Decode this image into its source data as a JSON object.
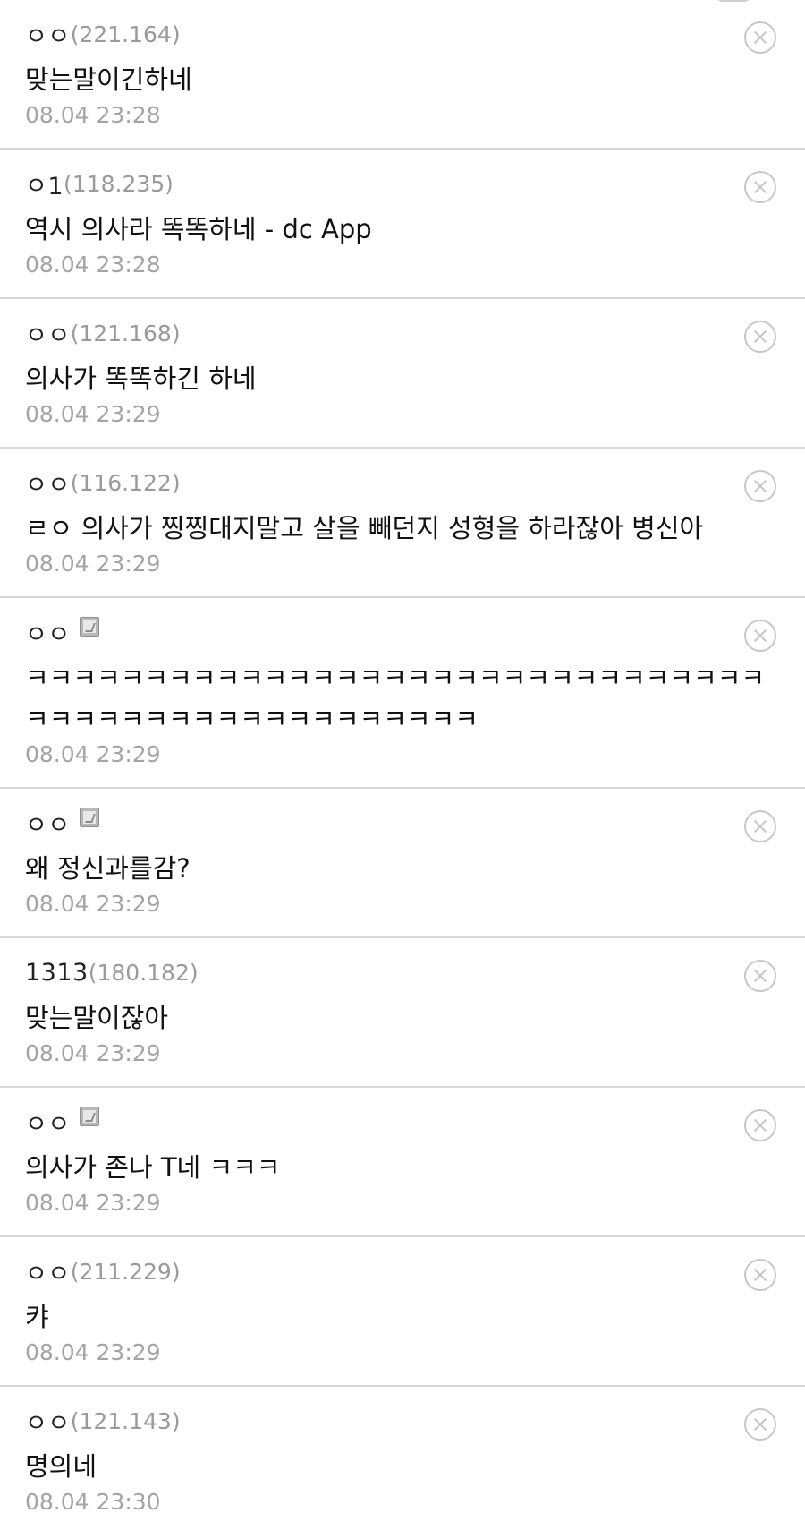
{
  "comments": [
    {
      "nick": "ㅇㅇ",
      "ip": "(221.164)",
      "fixed": false,
      "text": "맞는말이긴하네",
      "time": "08.04 23:28"
    },
    {
      "nick": "ㅇ1",
      "ip": "(118.235)",
      "fixed": false,
      "text": "역시 의사라 똑똑하네 - dc App",
      "time": "08.04 23:28"
    },
    {
      "nick": "ㅇㅇ",
      "ip": "(121.168)",
      "fixed": false,
      "text": "의사가 똑똑하긴 하네",
      "time": "08.04 23:29"
    },
    {
      "nick": "ㅇㅇ",
      "ip": "(116.122)",
      "fixed": false,
      "text": "ㄹㅇ 의사가 찡찡대지말고 살을 빼던지 성형을 하라잖아 병신아",
      "time": "08.04 23:29"
    },
    {
      "nick": "ㅇㅇ",
      "ip": "",
      "fixed": true,
      "text": "ㅋㅋㅋㅋㅋㅋㅋㅋㅋㅋㅋㅋㅋㅋㅋㅋㅋㅋㅋㅋㅋㅋㅋㅋㅋㅋㅋㅋㅋㅋㅋㅋㅋㅋㅋㅋㅋㅋㅋㅋㅋㅋㅋㅋㅋㅋㅋㅋㅋㅋ",
      "time": "08.04 23:29"
    },
    {
      "nick": "ㅇㅇ",
      "ip": "",
      "fixed": true,
      "text": "왜 정신과를감?",
      "time": "08.04 23:29"
    },
    {
      "nick": "1313",
      "ip": "(180.182)",
      "fixed": false,
      "text": "맞는말이잖아",
      "time": "08.04 23:29"
    },
    {
      "nick": "ㅇㅇ",
      "ip": "",
      "fixed": true,
      "text": "의사가 존나 T네 ㅋㅋㅋ",
      "time": "08.04 23:29"
    },
    {
      "nick": "ㅇㅇ",
      "ip": "(211.229)",
      "fixed": false,
      "text": "캬",
      "time": "08.04 23:29"
    },
    {
      "nick": "ㅇㅇ",
      "ip": "(121.143)",
      "fixed": false,
      "text": "명의네",
      "time": "08.04 23:30"
    }
  ]
}
